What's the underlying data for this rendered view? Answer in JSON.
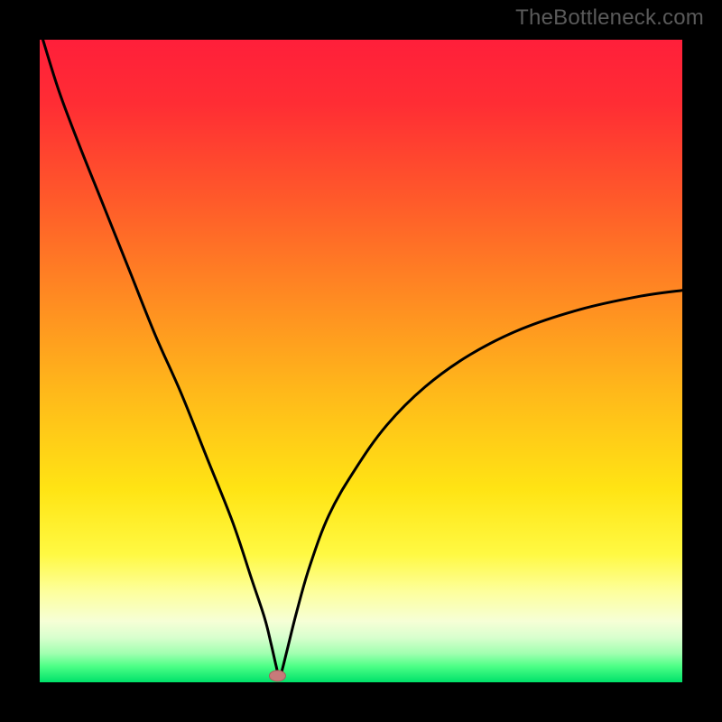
{
  "watermark": {
    "text": "TheBottleneck.com"
  },
  "colors": {
    "frame": "#000000",
    "gradient_stops": [
      {
        "offset": 0.0,
        "color": "#ff1f3a"
      },
      {
        "offset": 0.1,
        "color": "#ff2d34"
      },
      {
        "offset": 0.25,
        "color": "#ff5a2a"
      },
      {
        "offset": 0.4,
        "color": "#ff8a22"
      },
      {
        "offset": 0.55,
        "color": "#ffb91a"
      },
      {
        "offset": 0.7,
        "color": "#ffe414"
      },
      {
        "offset": 0.8,
        "color": "#fff942"
      },
      {
        "offset": 0.86,
        "color": "#fdff9e"
      },
      {
        "offset": 0.905,
        "color": "#f6ffd6"
      },
      {
        "offset": 0.93,
        "color": "#d9ffce"
      },
      {
        "offset": 0.955,
        "color": "#a1ffb0"
      },
      {
        "offset": 0.975,
        "color": "#4dff86"
      },
      {
        "offset": 1.0,
        "color": "#00e16a"
      }
    ],
    "curve": "#000000",
    "marker_fill": "#c77a7a",
    "marker_stroke": "#a85c5c"
  },
  "chart_data": {
    "type": "line",
    "title": "",
    "xlabel": "",
    "ylabel": "",
    "xlim": [
      0,
      100
    ],
    "ylim": [
      0,
      100
    ],
    "note": "No axis ticks or labels are rendered; values are normalized 0–100. The curve resembles a bottleneck percentage plot with a sharp minimum near x≈37 where y≈0, rising toward y≈100 at x→0 and toward y≈60 at x→100.",
    "series": [
      {
        "name": "bottleneck-curve",
        "x": [
          0.5,
          3,
          6,
          10,
          14,
          18,
          22,
          26,
          30,
          33,
          35,
          36,
          36.8,
          37.3,
          37.8,
          38.5,
          40,
          42,
          45,
          49,
          54,
          60,
          67,
          75,
          84,
          93,
          100
        ],
        "y": [
          100,
          92,
          84,
          74,
          64,
          54,
          45,
          35,
          25,
          16,
          10,
          6,
          2.5,
          0.6,
          2.2,
          5,
          11,
          18,
          26,
          33,
          40,
          46,
          51,
          55,
          58,
          60,
          61
        ]
      }
    ],
    "marker": {
      "name": "optimal-point",
      "x": 37.0,
      "y": 1.0
    }
  }
}
